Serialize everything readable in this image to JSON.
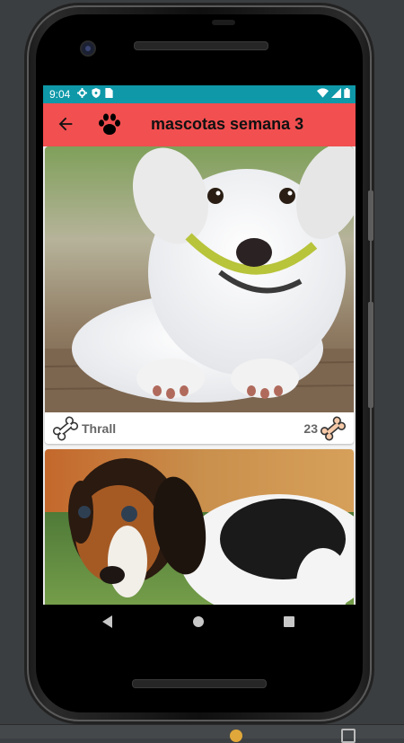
{
  "status_bar": {
    "time": "9:04",
    "background_color": "#0e98a8"
  },
  "app_bar": {
    "title": "mascotas semana 3",
    "background_color": "#f24f50",
    "back_icon": "arrow-left-icon",
    "logo_icon": "paw-icon"
  },
  "pets": [
    {
      "name": "Thrall",
      "likes": "23",
      "image": "white-puppy-photo",
      "bone_left_icon": "bone-outline-icon",
      "bone_right_icon": "bone-filled-icon"
    },
    {
      "name": "",
      "likes": "",
      "image": "beagle-puppy-photo"
    }
  ],
  "navigation": {
    "back_icon": "triangle-back-icon",
    "home_icon": "circle-home-icon",
    "recent_icon": "square-recents-icon"
  }
}
